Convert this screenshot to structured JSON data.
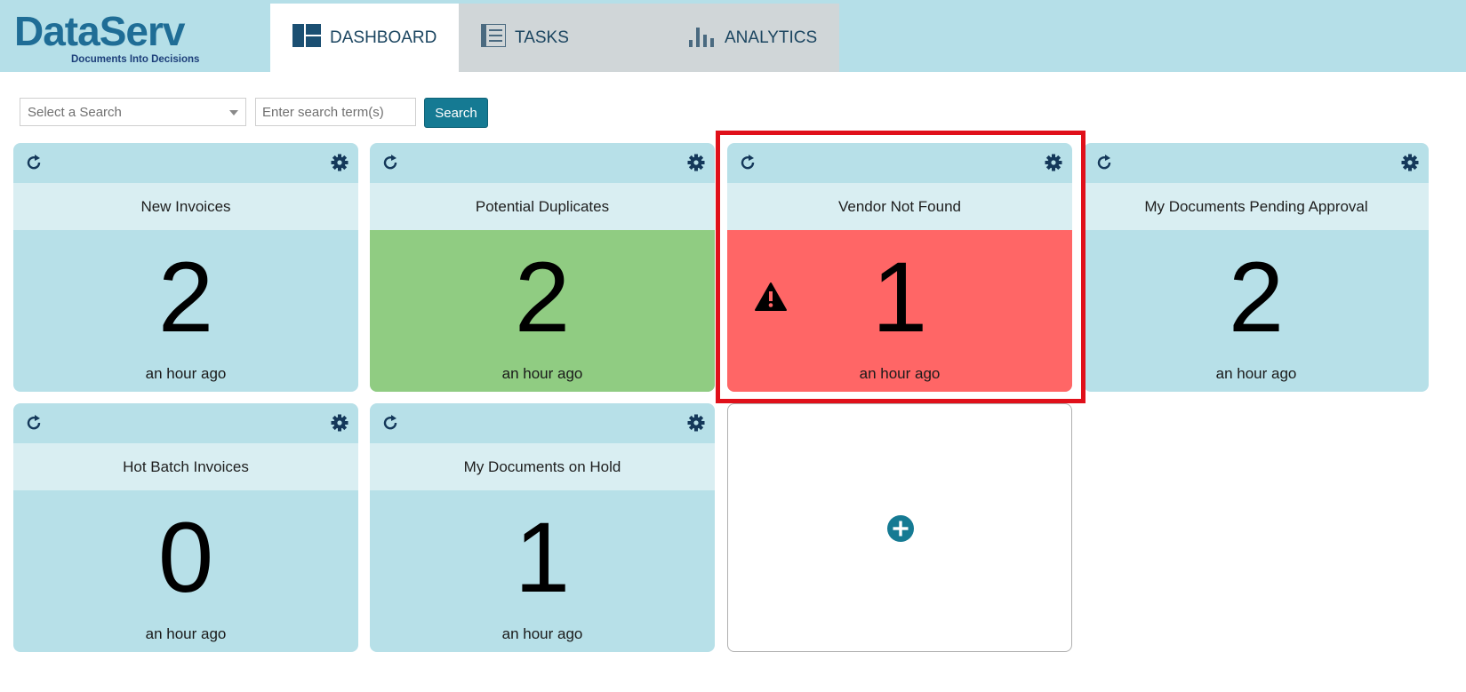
{
  "header": {
    "logo_text": "DataServ",
    "logo_tagline": "Documents Into Decisions",
    "tabs": [
      {
        "label": "DASHBOARD",
        "icon": "dashboard-icon",
        "active": true
      },
      {
        "label": "TASKS",
        "icon": "list-icon",
        "active": false
      },
      {
        "label": "ANALYTICS",
        "icon": "bar-chart-icon",
        "active": false
      }
    ]
  },
  "search": {
    "select_placeholder": "Select a Search",
    "input_placeholder": "Enter search term(s)",
    "button_label": "Search"
  },
  "tiles": [
    {
      "title": "New Invoices",
      "count": "2",
      "time": "an hour ago",
      "status": "default"
    },
    {
      "title": "Potential Duplicates",
      "count": "2",
      "time": "an hour ago",
      "status": "good",
      "status_color": "#90cc82"
    },
    {
      "title": "Vendor Not Found",
      "count": "1",
      "time": "an hour ago",
      "status": "warning",
      "status_color": "#ff6666",
      "highlighted": true
    },
    {
      "title": "My Documents Pending Approval",
      "count": "2",
      "time": "an hour ago",
      "status": "default"
    },
    {
      "title": "Hot Batch Invoices",
      "count": "0",
      "time": "an hour ago",
      "status": "default"
    },
    {
      "title": "My Documents on Hold",
      "count": "1",
      "time": "an hour ago",
      "status": "default"
    }
  ],
  "colors": {
    "header_bg": "#b5dfe8",
    "tile_bg": "#b7e0e8",
    "tile_title_bg": "#d9eef2",
    "accent": "#157a93",
    "highlight_border": "#e0101a"
  }
}
